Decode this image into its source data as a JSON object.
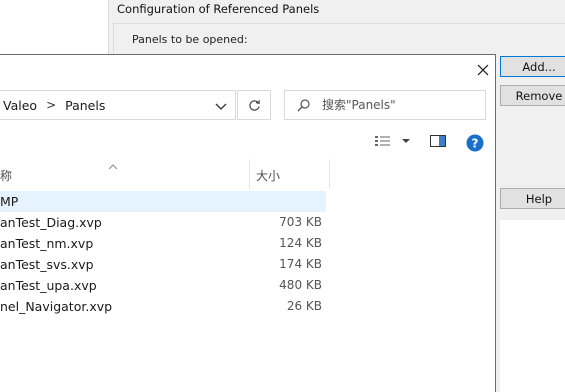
{
  "background_dialog": {
    "title": "Configuration of Referenced Panels",
    "panels_label": "Panels to be opened:",
    "buttons": {
      "add": "Add...",
      "remove": "Remove",
      "help": "Help"
    }
  },
  "file_dialog": {
    "breadcrumb": [
      "Valeo",
      "Panels"
    ],
    "breadcrumb_sep": ">",
    "search_placeholder": "搜索\"Panels\"",
    "columns": {
      "name": "称",
      "size": "大小"
    },
    "files": [
      {
        "name": "MP",
        "size": "",
        "selected": true
      },
      {
        "name": "anTest_Diag.xvp",
        "size": "703 KB"
      },
      {
        "name": "anTest_nm.xvp",
        "size": "124 KB"
      },
      {
        "name": "anTest_svs.xvp",
        "size": "174 KB"
      },
      {
        "name": "anTest_upa.xvp",
        "size": "480 KB"
      },
      {
        "name": "nel_Navigator.xvp",
        "size": "26 KB"
      }
    ],
    "icons": {
      "close": "close-icon",
      "dropdown": "chevron-down-icon",
      "refresh": "refresh-icon",
      "search": "search-icon",
      "views": "view-options-icon",
      "preview": "preview-pane-icon",
      "help": "help-icon",
      "sort": "sort-ascending-icon"
    },
    "colors": {
      "help_blue": "#1a6fc9",
      "selection": "#e5f3ff"
    }
  }
}
